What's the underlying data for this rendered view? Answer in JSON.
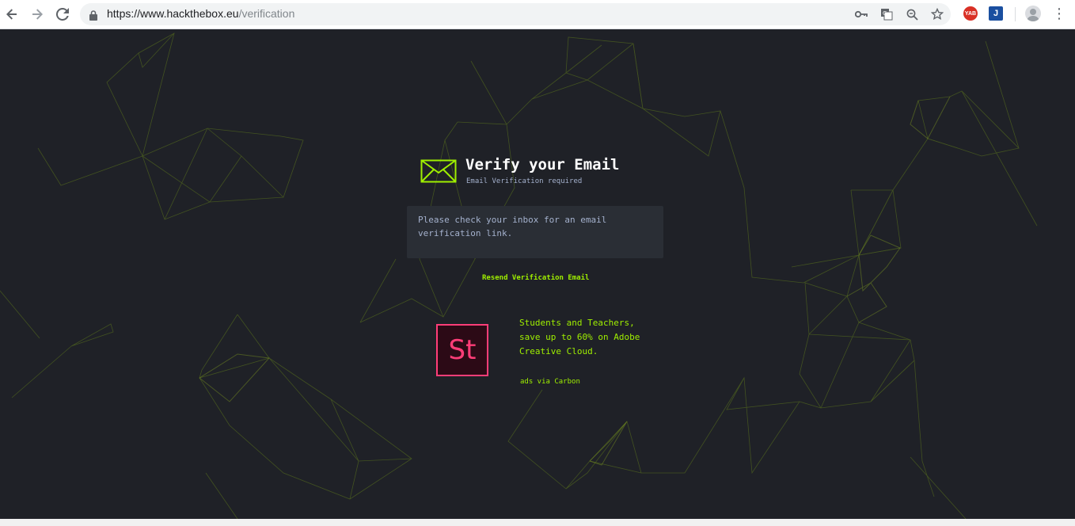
{
  "browser": {
    "url_secure": "https://",
    "url_host": "www.hackthebox.eu",
    "url_path": "/verification",
    "extensions": [
      {
        "label": "YAB",
        "color": "#d93025"
      },
      {
        "label": "J",
        "color": "#1a4fa0"
      }
    ]
  },
  "verification": {
    "title": "Verify your Email",
    "subtitle": "Email Verification required",
    "message": "Please check your inbox for an email verification link.",
    "resend_label": "Resend Verification Email"
  },
  "ad": {
    "logo_text": "St",
    "text": "Students and Teachers, save up to 60% on Adobe Creative Cloud.",
    "via": "ads via Carbon"
  },
  "colors": {
    "accent": "#9fef00",
    "background": "#1f2127",
    "panel": "#2a2e35",
    "ad_brand": "#ff3d78"
  }
}
